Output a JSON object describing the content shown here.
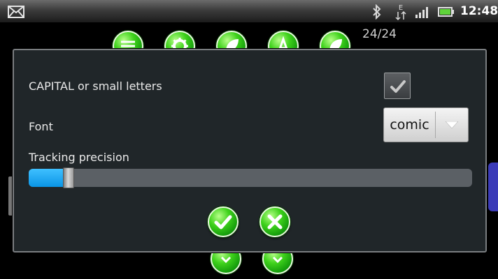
{
  "status_bar": {
    "time": "12:48",
    "icons": [
      "mail-icon",
      "bluetooth-icon",
      "data-e-icon",
      "signal-icon",
      "battery-icon"
    ],
    "data_indicator": "E"
  },
  "background": {
    "counter": "24/24",
    "top_buttons": [
      "list-icon",
      "gear-icon",
      "leaf-icon",
      "letter-a-icon",
      "leaf-icon"
    ],
    "bottom_buttons": [
      "arrow-down-icon",
      "arrow-down-icon"
    ]
  },
  "dialog": {
    "case_label": "CAPITAL or small letters",
    "case_checked": true,
    "font_label": "Font",
    "font_value": "comic",
    "tracking_label": "Tracking precision",
    "tracking_value_percent": 9,
    "ok_icon": "checkmark-icon",
    "cancel_icon": "x-icon"
  },
  "colors": {
    "accent_blue": "#1aa6f0",
    "button_green": "#2fc114",
    "dialog_bg": "#202629"
  }
}
